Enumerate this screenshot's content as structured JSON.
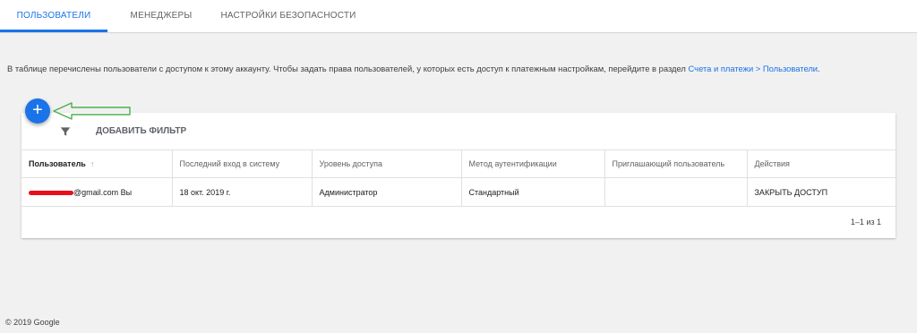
{
  "tabs": [
    {
      "label": "Пользователи",
      "active": true
    },
    {
      "label": "Менеджеры",
      "active": false
    },
    {
      "label": "Настройки безопасности",
      "active": false
    }
  ],
  "description": {
    "text": "В таблице перечислены пользователи с доступом к этому аккаунту. Чтобы задать права пользователей, у которых есть доступ к платежным настройкам, перейдите в раздел ",
    "link": "Счета и платежи > Пользователи",
    "suffix": "."
  },
  "fab": {
    "icon": "plus-icon",
    "label": "+"
  },
  "filter": {
    "icon": "filter-icon",
    "label": "ДОБАВИТЬ ФИЛЬТР"
  },
  "table": {
    "columns": [
      "Пользователь",
      "Последний вход в систему",
      "Уровень доступа",
      "Метод аутентификации",
      "Приглашающий пользователь",
      "Действия"
    ],
    "sort_arrow": "↑",
    "rows": [
      {
        "user": "@gmail.com Вы",
        "last_login": "18 окт. 2019 г.",
        "access": "Администратор",
        "auth": "Стандартный",
        "inviter": "",
        "action": "ЗАКРЫТЬ ДОСТУП"
      }
    ]
  },
  "pagination": "1–1 из 1",
  "footer": "© 2019 Google",
  "colors": {
    "accent": "#1a73e8",
    "redaction": "#e8101a",
    "annotation_arrow": "#4caf50"
  }
}
